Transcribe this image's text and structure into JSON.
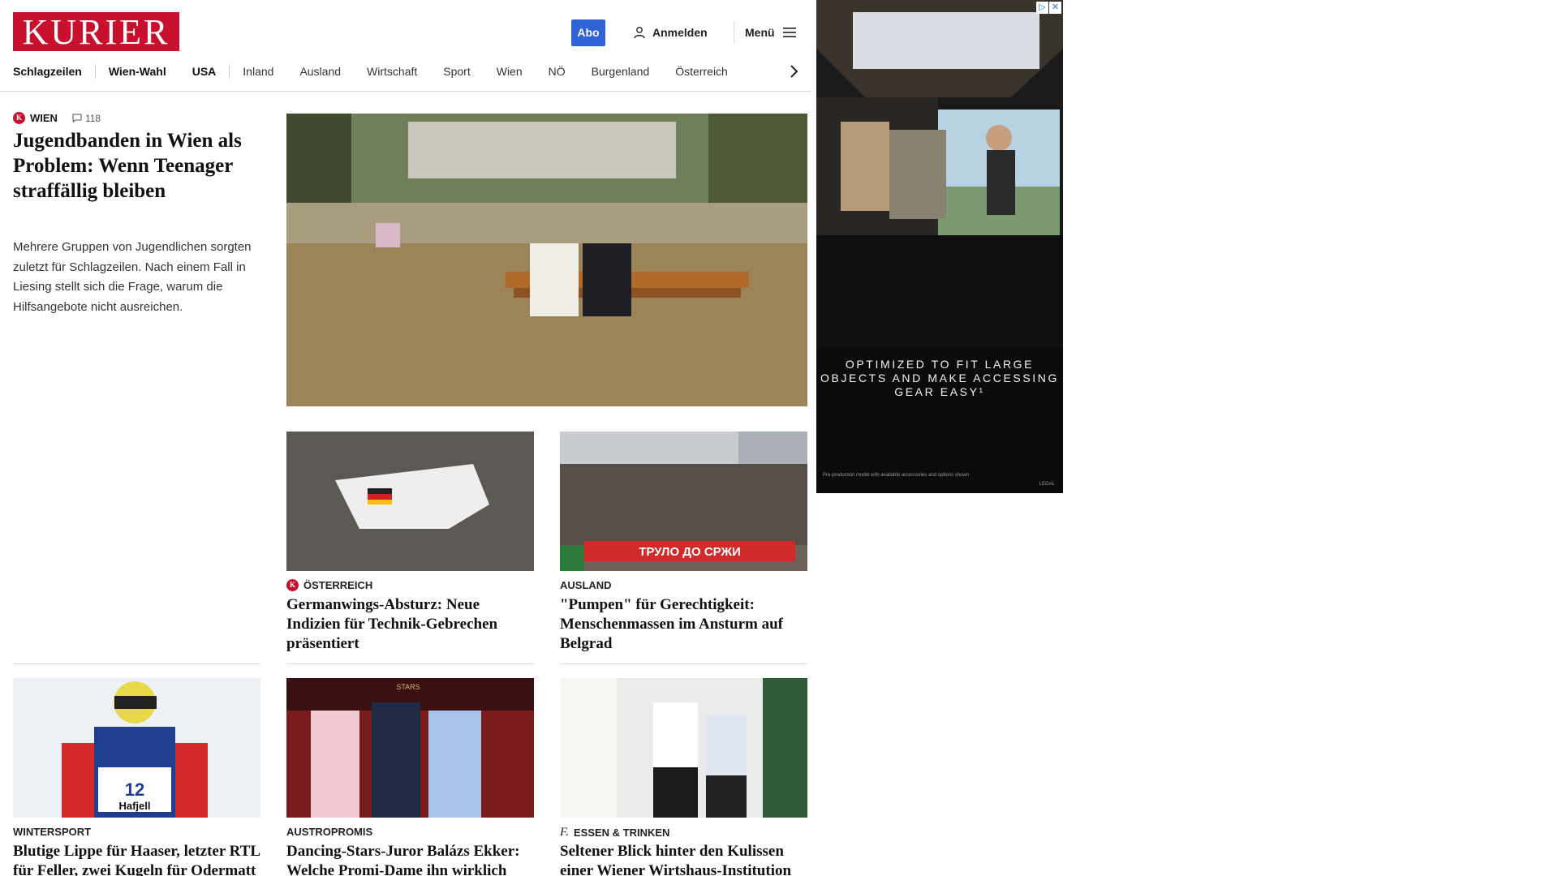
{
  "header": {
    "logo": "KURIER",
    "abo_label": "Abo",
    "login_label": "Anmelden",
    "menu_label": "Menü"
  },
  "nav": {
    "items": [
      "Schlagzeilen",
      "Wien-Wahl",
      "USA",
      "Inland",
      "Ausland",
      "Wirtschaft",
      "Sport",
      "Wien",
      "NÖ",
      "Burgenland",
      "Österreich"
    ]
  },
  "lead": {
    "kicker": "WIEN",
    "comment_count": "118",
    "title": "Jugendbanden in Wien als Problem: Wenn Teenager straffällig bleiben",
    "teaser": "Mehrere Gruppen von Jugendlichen sorgten zuletzt für Schlagzeilen. Nach einem Fall in Liesing stellt sich die Frage, warum die Hilfsangebote nicht ausreichen."
  },
  "cards": [
    {
      "kicker": "ÖSTERREICH",
      "title": "Germanwings-Absturz: Neue Indizien für Technik-Gebrechen präsentiert",
      "badge": "kurier-k-icon"
    },
    {
      "kicker": "AUSLAND",
      "title": "\"Pumpen\" für Gerechtigkeit: Menschenmassen im Ansturm auf Belgrad"
    },
    {
      "kicker": "WINTERSPORT",
      "title": "Blutige Lippe für Haaser, letzter RTL für Feller, zwei Kugeln für Odermatt"
    },
    {
      "kicker": "AUSTROPROMIS",
      "title": "Dancing-Stars-Juror Balázs Ekker: Welche Promi-Dame ihn wirklich überrascht hat"
    },
    {
      "kicker": "ESSEN & TRINKEN",
      "title": "Seltener Blick hinter den Kulissen einer Wiener Wirtshaus-Institution",
      "badge": "freizeit-f-icon"
    }
  ],
  "image_texts": {
    "protest_banner": "ТРУЛО ДО СРЖИ",
    "bib_number": "12",
    "bib_location": "Hafjell",
    "dancing_sign": "STARS"
  },
  "ad": {
    "headline": "OPTIMIZED TO FIT LARGE OBJECTS AND MAKE ACCESSING GEAR EASY¹",
    "fine_print": "Pre-production model with available accessories and options shown",
    "legal": "LEGAL"
  },
  "colors": {
    "brand_red": "#c8102e",
    "abo_blue": "#2f62d6"
  }
}
